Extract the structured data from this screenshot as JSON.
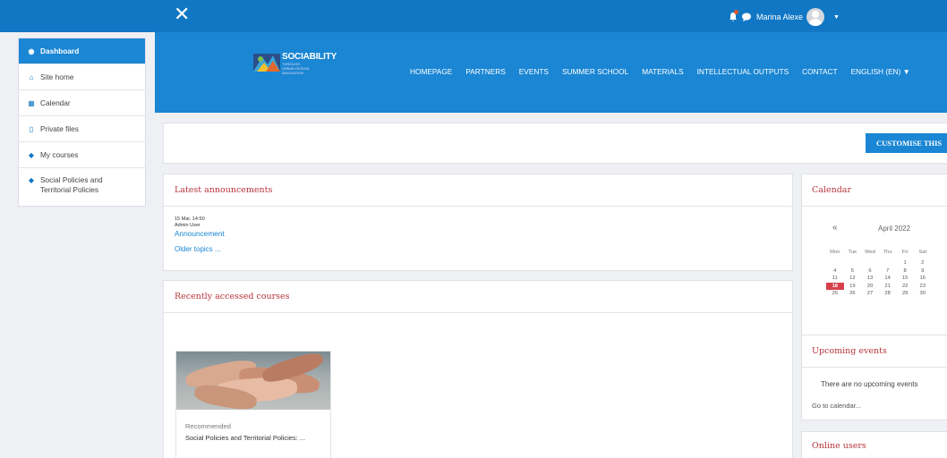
{
  "navbar": {
    "close_glyph": "✕",
    "user_name": "Marina Alexe",
    "caret": "▼",
    "icons": [
      "bell-icon",
      "chat-icon",
      "avatar"
    ],
    "color": "#1177c4"
  },
  "banner": {
    "logo_title": "SOCIABILITY",
    "logo_sub_lines": [
      "THROUGH",
      "URBAN DESIGN",
      "INNOVATION"
    ],
    "menu": [
      "HOMEPAGE",
      "PARTNERS",
      "EVENTS",
      "SUMMER SCHOOL",
      "MATERIALS",
      "INTELLECTUAL OUTPUTS",
      "CONTACT",
      "ENGLISH (EN) ▼"
    ]
  },
  "drawer": {
    "items": [
      {
        "label": "Dashboard",
        "icon": "dashboard-icon",
        "glyph": "◉",
        "active": true
      },
      {
        "label": "Site home",
        "icon": "home-icon",
        "glyph": "⌂"
      },
      {
        "label": "Calendar",
        "icon": "calendar-icon",
        "glyph": "▦"
      },
      {
        "label": "Private files",
        "icon": "file-icon",
        "glyph": "▯"
      },
      {
        "label": "My courses",
        "icon": "graduation-cap-icon",
        "glyph": "◆"
      },
      {
        "label": "Social Policies and Territorial Policies",
        "icon": "graduation-cap-icon",
        "glyph": "◆"
      }
    ]
  },
  "customise": {
    "button_label": "CUSTOMISE THIS"
  },
  "announcements": {
    "title": "Latest announcements",
    "date": "15 Mar, 14:50",
    "author": "Admin User",
    "link": "Announcement",
    "older": "Older topics ..."
  },
  "recent": {
    "title": "Recently accessed courses",
    "course_category": "Recommended",
    "course_name": "Social Policies and Territorial Policies: ..."
  },
  "calendar": {
    "title": "Calendar",
    "prev": "«",
    "month": "April 2022",
    "weekdays": [
      "Mon",
      "Tue",
      "Wed",
      "Thu",
      "Fri",
      "Sat"
    ],
    "weeks": [
      [
        "",
        "",
        "",
        "",
        "1",
        "2"
      ],
      [
        "4",
        "5",
        "6",
        "7",
        "8",
        "9"
      ],
      [
        "11",
        "12",
        "13",
        "14",
        "15",
        "16"
      ],
      [
        "18",
        "19",
        "20",
        "21",
        "22",
        "23"
      ],
      [
        "25",
        "26",
        "27",
        "28",
        "29",
        "30"
      ]
    ],
    "today": "18",
    "today_color": "#d6404a"
  },
  "upcoming": {
    "title": "Upcoming events",
    "empty_text": "There are no upcoming events",
    "link": "Go to calendar..."
  },
  "online": {
    "title": "Online users"
  }
}
